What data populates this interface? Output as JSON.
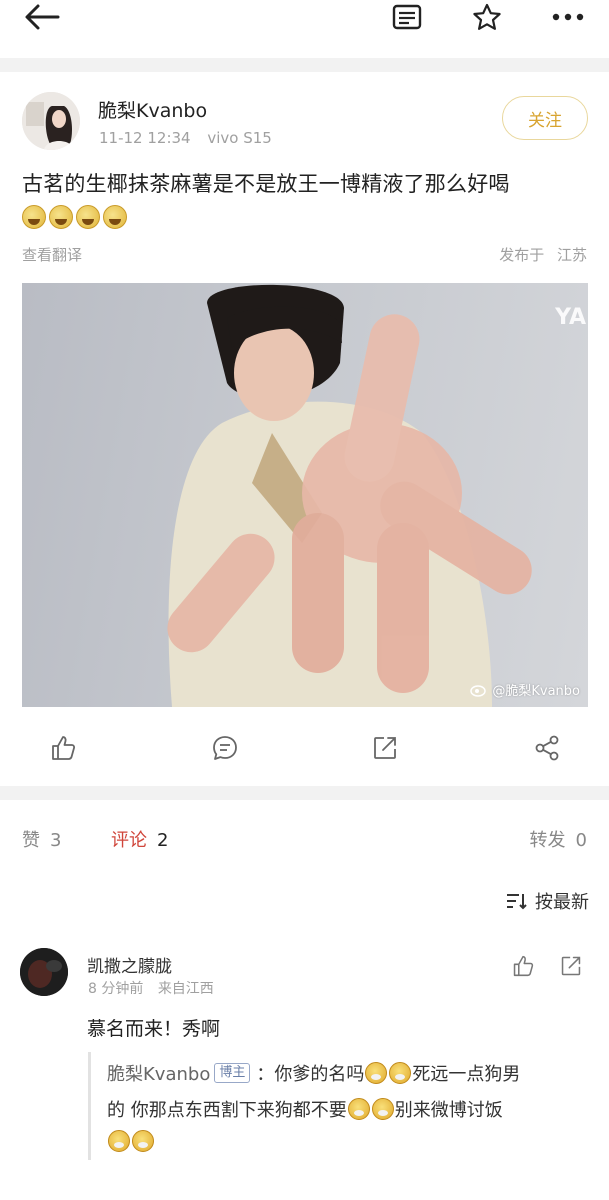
{
  "nav": {
    "back_icon": "arrow-left-icon",
    "notes_icon": "notes-icon",
    "star_icon": "star-icon",
    "more_icon": "more-icon"
  },
  "post": {
    "username": "脆梨Kvanbo",
    "time": "11-12 12:34",
    "device": "vivo S15",
    "follow_label": "关注",
    "text": "古茗的生椰抹茶麻薯是不是放王一博精液了那么好喝",
    "translate_label": "查看翻译",
    "location_prefix": "发布于",
    "location": "江苏",
    "image_watermark": "@脆梨Kvanbo",
    "image_corner_text": "YA",
    "emoji_count": 4,
    "emoji_icon": "laughing-tears-emoji"
  },
  "actions": {
    "like_icon": "thumb-up-icon",
    "comment_icon": "comment-icon",
    "repost_icon": "repost-icon",
    "share_icon": "share-icon"
  },
  "tabs": {
    "like_label": "赞",
    "like_count": "3",
    "comment_label": "评论",
    "comment_count": "2",
    "repost_label": "转发",
    "repost_count": "0",
    "sort_label": "按最新"
  },
  "comment": {
    "name": "凯撒之朦胧",
    "time": "8 分钟前",
    "source": "来自江西",
    "text": "慕名而来！秀啊",
    "reply": {
      "name": "脆梨Kvanbo",
      "badge": "博主",
      "text_1": "：你爹的名吗",
      "text_2": "死远一点狗男",
      "text_3": "的 你那点东西割下来狗都不要",
      "text_4": "别来微博讨饭",
      "emoji_icon": "scream-emoji"
    }
  },
  "colors": {
    "accent_red": "#d0463b",
    "follow_gold": "#d8a430",
    "muted": "#a0a0a0"
  }
}
